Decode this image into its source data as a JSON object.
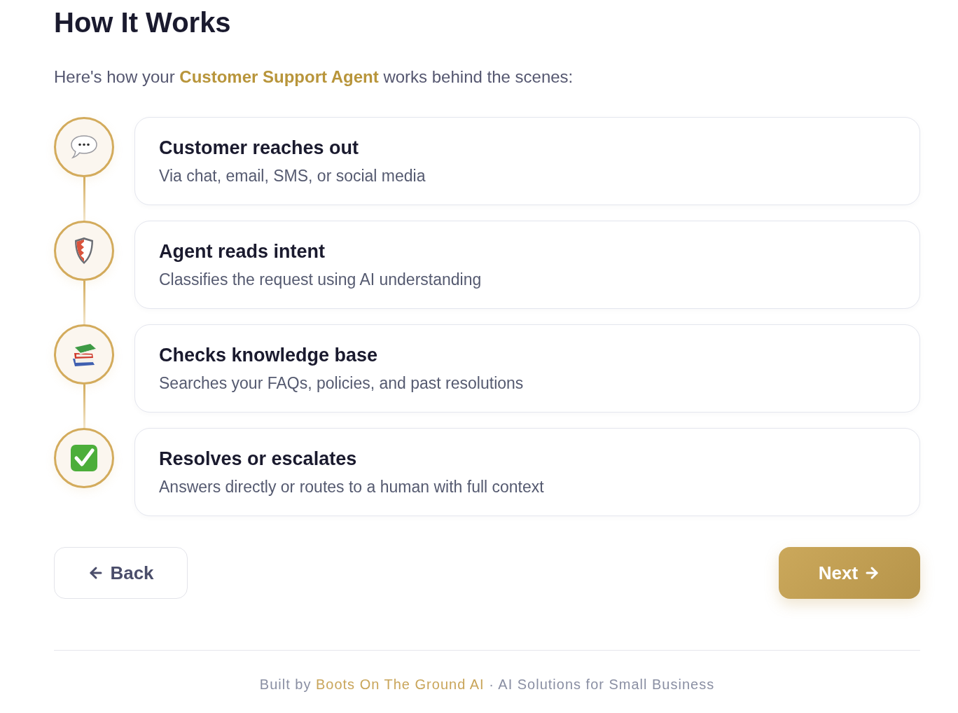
{
  "page": {
    "title": "How It Works",
    "intro": "Here's how your **Customer Support Agent** works behind the scenes:"
  },
  "steps": [
    {
      "title": "Customer reaches out",
      "description": "Via chat, email, SMS, or social media"
    },
    {
      "title": "Agent reads intent",
      "description": "Classifies the request using AI understanding"
    },
    {
      "title": "Checks knowledge base",
      "description": "Searches your FAQs, policies, and past resolutions"
    },
    {
      "title": "Resolves or escalates",
      "description": "Answers directly or routes to a human with full context"
    }
  ],
  "buttons": {
    "back": "Back",
    "next": "Next"
  },
  "footer": {
    "prefix": "Built by",
    "brand": "Boots On The Ground AI",
    "suffix": "· AI Solutions for Small Business"
  }
}
